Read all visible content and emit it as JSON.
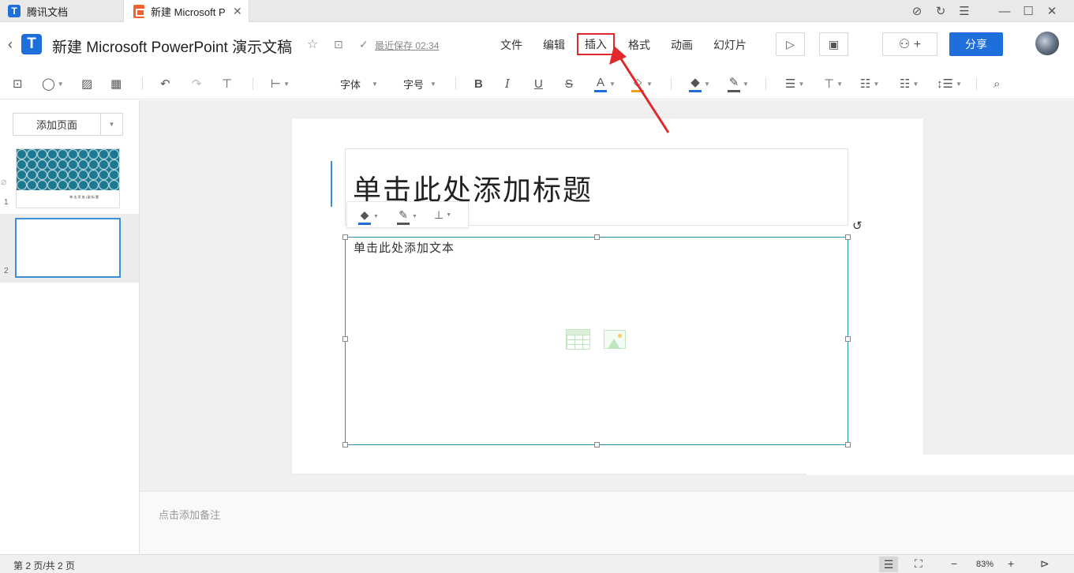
{
  "window": {
    "tabs": [
      {
        "label": "腾讯文档"
      },
      {
        "label": "新建 Microsoft P",
        "close": "✕"
      }
    ]
  },
  "header": {
    "back_icon": "chevron-left-icon",
    "doc_title": "新建 Microsoft PowerPoint 演示文稿",
    "saved_text": "最近保存 02:34",
    "menus": [
      "文件",
      "编辑",
      "插入",
      "格式",
      "动画",
      "幻灯片"
    ],
    "active_menu": "插入",
    "share_label": "分享"
  },
  "toolbar": {
    "font_label": "字体",
    "size_label": "字号",
    "colors": {
      "font": "#1e6fd9",
      "highlight": "#f0a020",
      "fill": "#1e6fd9",
      "border": "#555555"
    }
  },
  "sidebar": {
    "add_page_label": "添加页面",
    "slides": [
      {
        "number": "1",
        "caption": "单 击 添 加   |   副 标 题"
      },
      {
        "number": "2"
      }
    ],
    "selected": 2
  },
  "slide": {
    "title_placeholder": "单击此处添加标题",
    "body_placeholder": "单击此处添加文本"
  },
  "notes": {
    "placeholder": "点击添加备注"
  },
  "status": {
    "page_info": "第 2 页/共 2 页",
    "zoom": "83%"
  },
  "colors": {
    "accent": "#1e6fd9",
    "annotation": "#e0292c",
    "selection": "#2b91b5"
  }
}
